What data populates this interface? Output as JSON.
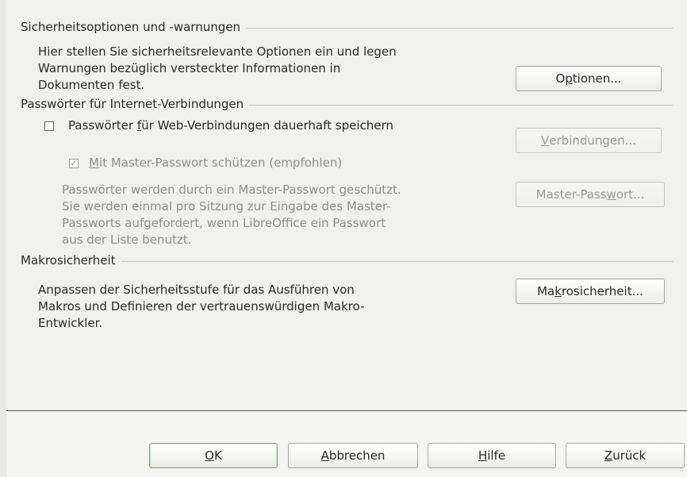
{
  "security": {
    "title": "Sicherheitsoptionen und -warnungen",
    "desc_lines": [
      "Hier stellen Sie sicherheitsrelevante Optionen ein und legen",
      "Warnungen bezüglich versteckter Informationen in",
      "Dokumenten fest."
    ],
    "options_button": {
      "pre": "O",
      "key": "p",
      "post": "tionen..."
    }
  },
  "passwords": {
    "title": "Passwörter für Internet-Verbindungen",
    "save_checkbox": {
      "checked": false,
      "pre": "Passwörter ",
      "key": "f",
      "post": "ür Web-Verbindungen dauerhaft speichern"
    },
    "connections_button": {
      "pre": "",
      "key": "V",
      "post": "erbindungen...",
      "enabled": false
    },
    "master_checkbox": {
      "checked": true,
      "enabled": false,
      "pre": "",
      "key": "M",
      "post": "it Master-Passwort schützen (empfohlen)"
    },
    "master_button": {
      "pre": "Master-Pass",
      "key": "w",
      "post": "ort...",
      "enabled": false
    },
    "info_lines": [
      "Passwörter werden durch ein Master-Passwort geschützt.",
      "Sie werden einmal pro Sitzung zur Eingabe des Master-",
      "Passworts aufgefordert, wenn LibreOffice ein Passwort",
      "aus der Liste benutzt."
    ]
  },
  "macro": {
    "title": "Makrosicherheit",
    "desc_lines": [
      "Anpassen der Sicherheitsstufe für das Ausführen von",
      "Makros und Definieren der vertrauenswürdigen Makro-",
      "Entwickler."
    ],
    "button": {
      "pre": "Ma",
      "key": "k",
      "post": "rosicherheit..."
    }
  },
  "footer": {
    "ok": {
      "pre": "",
      "key": "O",
      "post": "K"
    },
    "cancel": {
      "pre": "",
      "key": "A",
      "post": "bbrechen"
    },
    "help": {
      "pre": "",
      "key": "H",
      "post": "ilfe"
    },
    "back": {
      "pre": "",
      "key": "Z",
      "post": "urück"
    }
  }
}
